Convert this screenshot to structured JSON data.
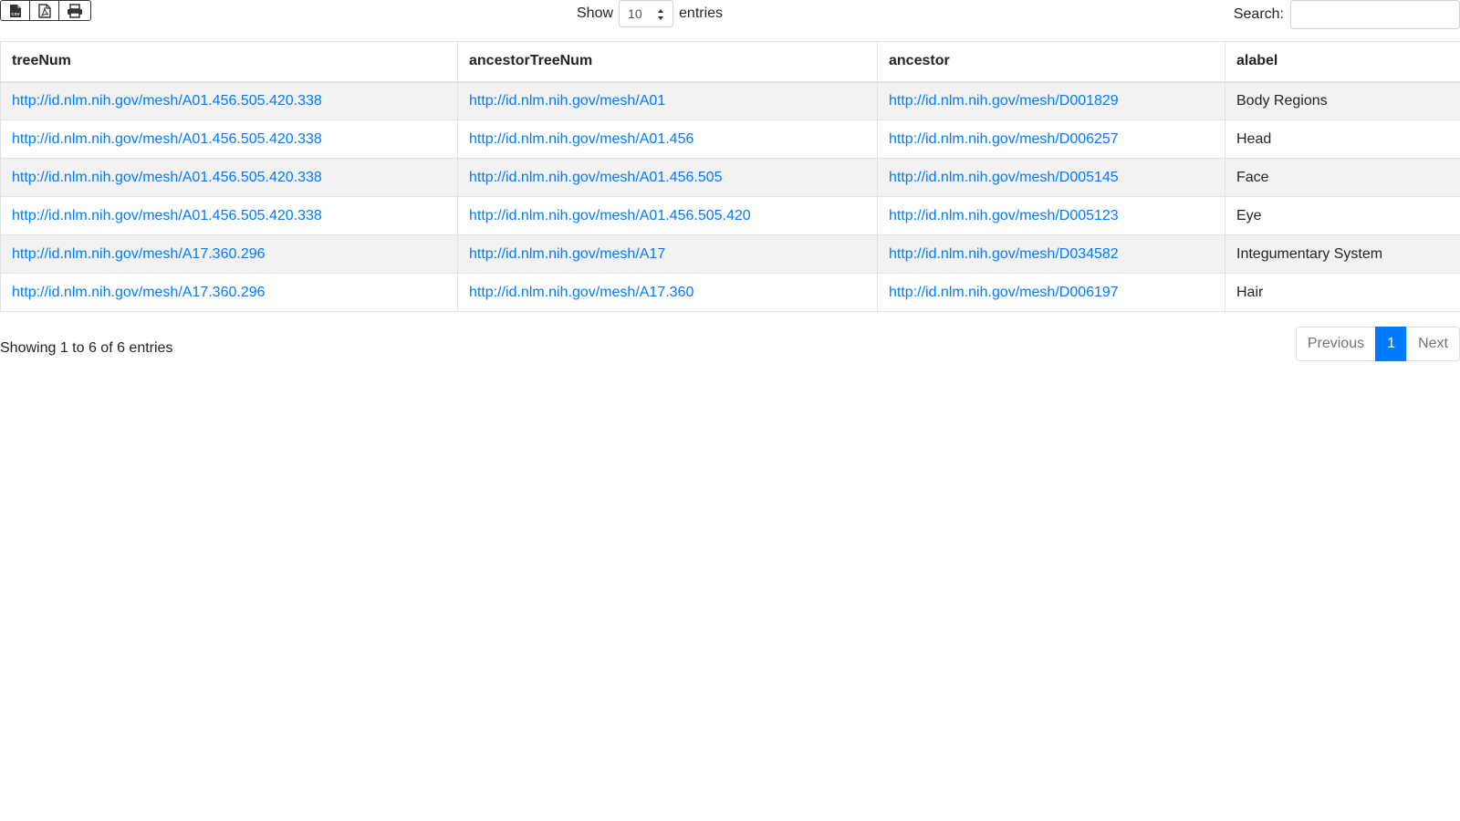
{
  "toolbar": {
    "export_buttons": [
      {
        "icon": "csv-file-icon"
      },
      {
        "icon": "pdf-file-icon"
      },
      {
        "icon": "print-icon"
      }
    ]
  },
  "length": {
    "show_label": "Show",
    "selected": "10",
    "entries_label": "entries"
  },
  "search": {
    "label": "Search:",
    "value": "",
    "placeholder": ""
  },
  "table": {
    "columns": [
      "treeNum",
      "ancestorTreeNum",
      "ancestor",
      "alabel"
    ],
    "rows": [
      {
        "treeNum": "http://id.nlm.nih.gov/mesh/A01.456.505.420.338",
        "ancestorTreeNum": "http://id.nlm.nih.gov/mesh/A01",
        "ancestor": "http://id.nlm.nih.gov/mesh/D001829",
        "alabel": "Body Regions"
      },
      {
        "treeNum": "http://id.nlm.nih.gov/mesh/A01.456.505.420.338",
        "ancestorTreeNum": "http://id.nlm.nih.gov/mesh/A01.456",
        "ancestor": "http://id.nlm.nih.gov/mesh/D006257",
        "alabel": "Head"
      },
      {
        "treeNum": "http://id.nlm.nih.gov/mesh/A01.456.505.420.338",
        "ancestorTreeNum": "http://id.nlm.nih.gov/mesh/A01.456.505",
        "ancestor": "http://id.nlm.nih.gov/mesh/D005145",
        "alabel": "Face"
      },
      {
        "treeNum": "http://id.nlm.nih.gov/mesh/A01.456.505.420.338",
        "ancestorTreeNum": "http://id.nlm.nih.gov/mesh/A01.456.505.420",
        "ancestor": "http://id.nlm.nih.gov/mesh/D005123",
        "alabel": "Eye"
      },
      {
        "treeNum": "http://id.nlm.nih.gov/mesh/A17.360.296",
        "ancestorTreeNum": "http://id.nlm.nih.gov/mesh/A17",
        "ancestor": "http://id.nlm.nih.gov/mesh/D034582",
        "alabel": "Integumentary System"
      },
      {
        "treeNum": "http://id.nlm.nih.gov/mesh/A17.360.296",
        "ancestorTreeNum": "http://id.nlm.nih.gov/mesh/A17.360",
        "ancestor": "http://id.nlm.nih.gov/mesh/D006197",
        "alabel": "Hair"
      }
    ]
  },
  "info": "Showing 1 to 6 of 6 entries",
  "pagination": {
    "previous": "Previous",
    "current": "1",
    "next": "Next"
  },
  "colors": {
    "link": "#007bff",
    "active_page": "#007bff",
    "stripe": "#f2f2f2"
  }
}
